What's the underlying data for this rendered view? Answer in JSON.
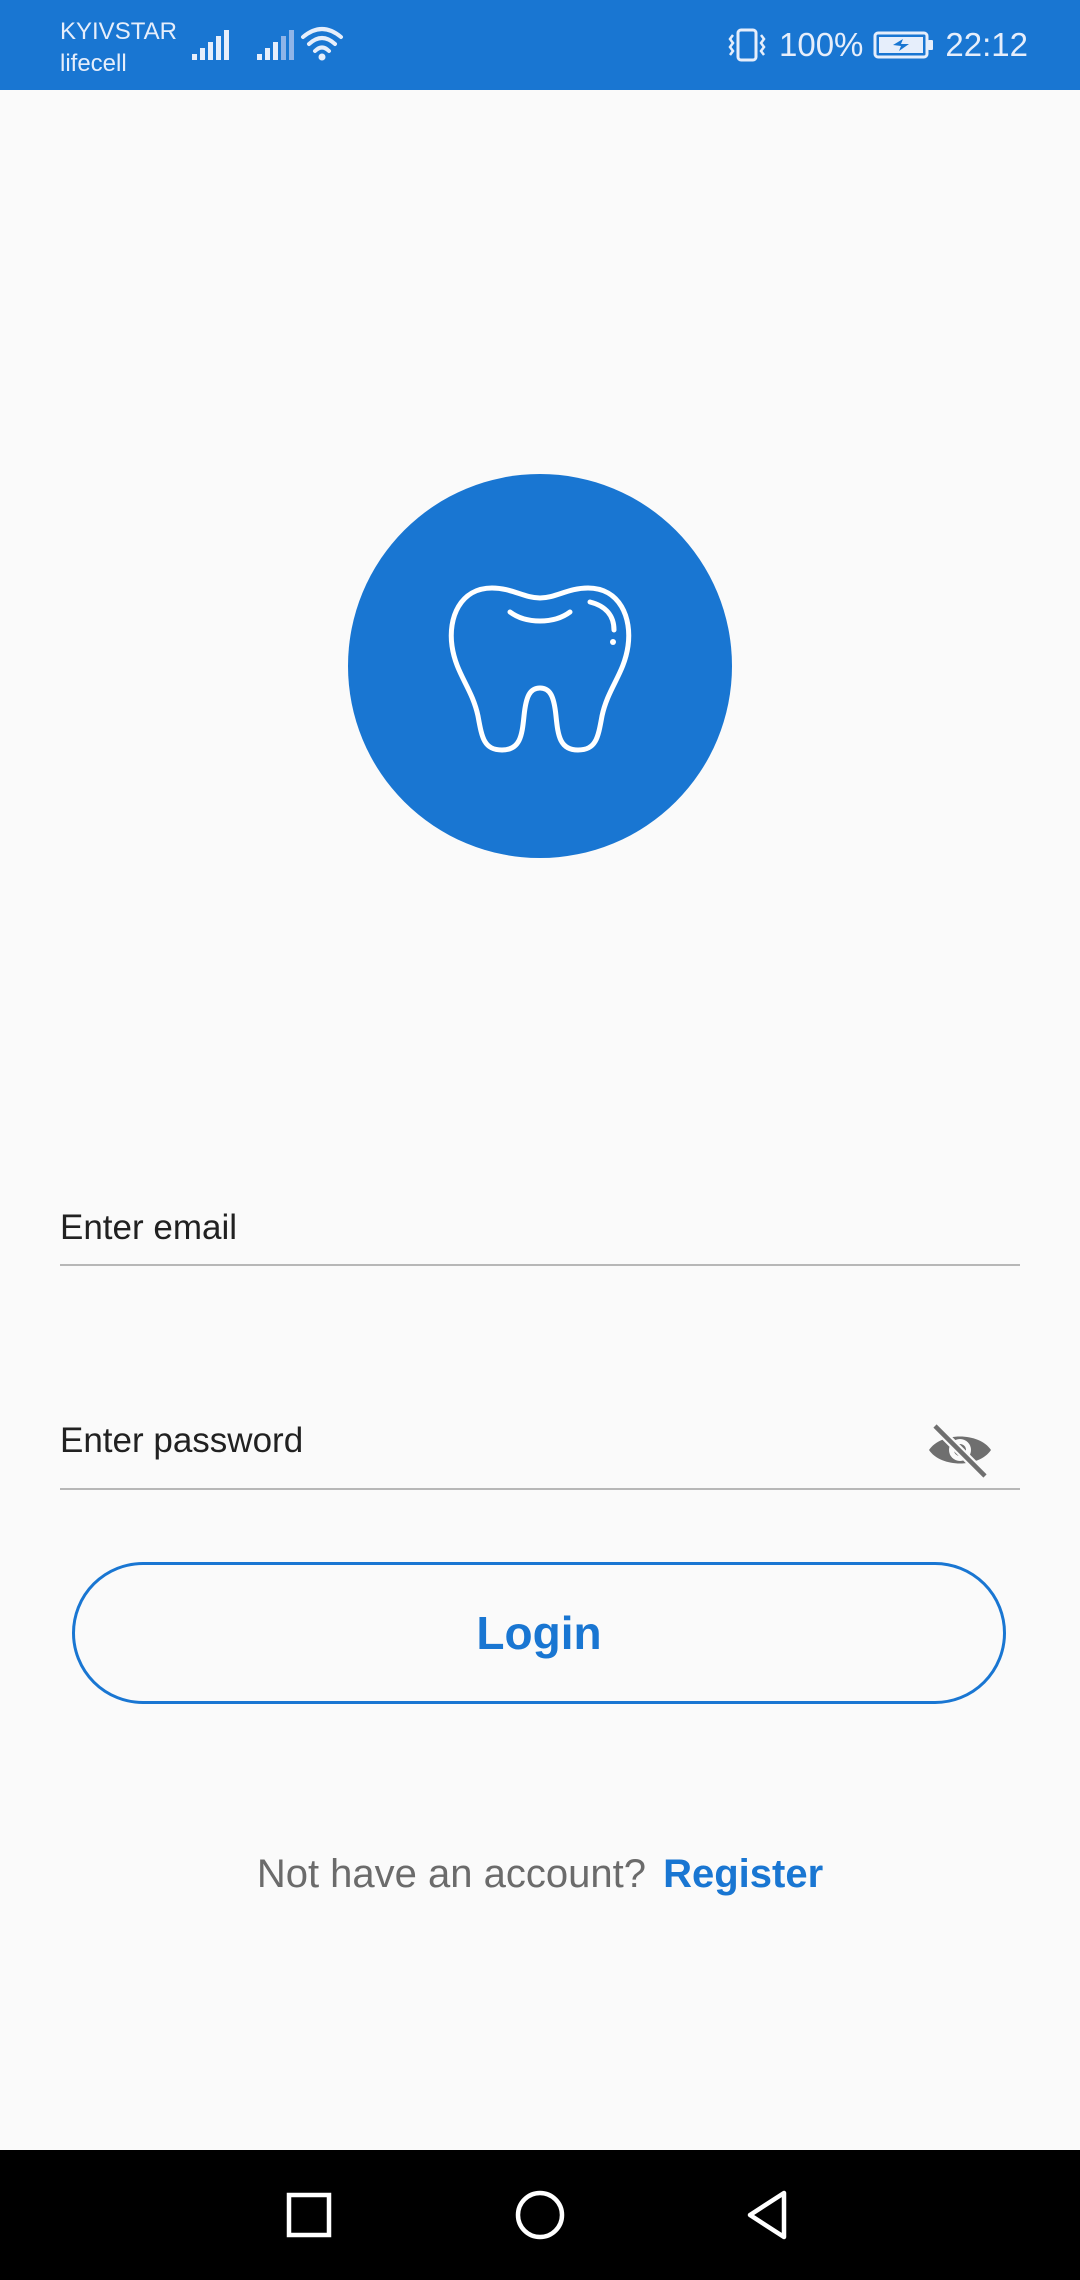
{
  "status_bar": {
    "carrier_1": "KYIVSTAR",
    "carrier_2": "lifecell",
    "battery_percent": "100%",
    "time": "22:12",
    "icons": [
      "signal-icon",
      "signal-icon",
      "wifi-icon",
      "vibrate-icon",
      "battery-charging-icon"
    ],
    "background_color": "#1976d2"
  },
  "logo": {
    "icon": "tooth-icon",
    "circle_color": "#1976d2"
  },
  "form": {
    "email_placeholder": "Enter email",
    "password_placeholder": "Enter password",
    "visibility_icon": "eye-off-icon",
    "login_label": "Login"
  },
  "register": {
    "prompt": "Not have an account?",
    "link_label": "Register"
  },
  "nav_bar": {
    "icons": [
      "recent-apps-icon",
      "home-icon",
      "back-icon"
    ]
  },
  "colors": {
    "accent": "#1976d2",
    "background": "#fafafa",
    "muted_text": "#6b6b6b"
  }
}
